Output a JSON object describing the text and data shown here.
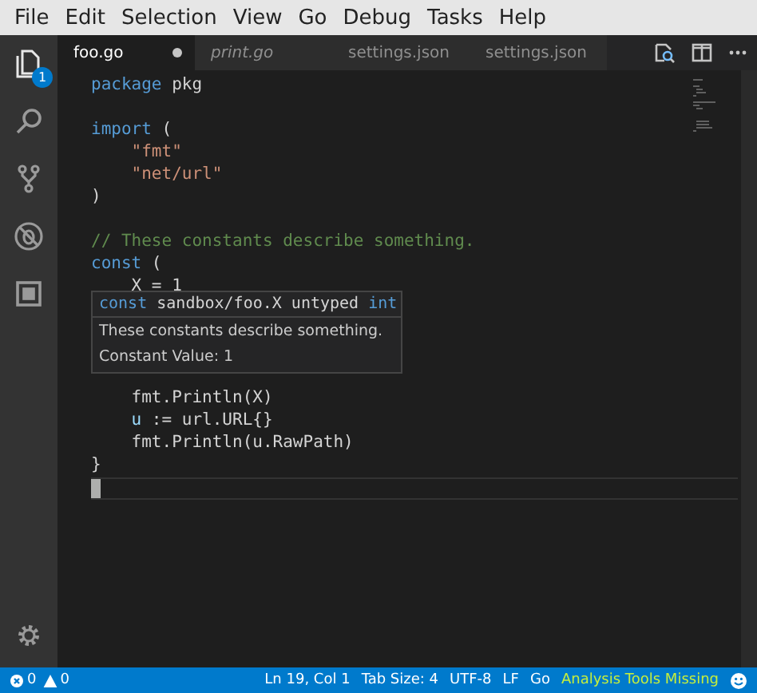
{
  "menu": [
    "File",
    "Edit",
    "Selection",
    "View",
    "Go",
    "Debug",
    "Tasks",
    "Help"
  ],
  "activity_bar": {
    "items": [
      {
        "kind": "files",
        "selected": true,
        "badge": "1"
      },
      {
        "kind": "search",
        "selected": false
      },
      {
        "kind": "source-control",
        "selected": false
      },
      {
        "kind": "debug",
        "selected": false
      },
      {
        "kind": "extensions",
        "selected": false
      }
    ]
  },
  "tabs": [
    {
      "label": "foo.go",
      "selected": true,
      "dirty": true,
      "preview": false
    },
    {
      "label": "print.go",
      "selected": false,
      "dirty": false,
      "preview": true
    },
    {
      "label": "settings.json",
      "selected": false,
      "dirty": false,
      "preview": false
    },
    {
      "label": "settings.json",
      "selected": false,
      "dirty": false,
      "preview": false
    }
  ],
  "code_lines": [
    {
      "kind": "code",
      "tokens": [
        {
          "text": "package",
          "kind": "keyword"
        },
        {
          "text": " pkg",
          "kind": "plain"
        }
      ]
    },
    {
      "kind": "blank"
    },
    {
      "kind": "code",
      "tokens": [
        {
          "text": "import",
          "kind": "keyword"
        },
        {
          "text": " (",
          "kind": "plain"
        }
      ]
    },
    {
      "kind": "code",
      "tokens": [
        {
          "text": "    \"fmt\"",
          "kind": "string"
        }
      ]
    },
    {
      "kind": "code",
      "tokens": [
        {
          "text": "    \"net/url\"",
          "kind": "string"
        }
      ]
    },
    {
      "kind": "code",
      "tokens": [
        {
          "text": ")",
          "kind": "plain"
        }
      ]
    },
    {
      "kind": "blank"
    },
    {
      "kind": "code",
      "tokens": [
        {
          "text": "// These constants describe something.",
          "kind": "comment"
        }
      ]
    },
    {
      "kind": "code",
      "tokens": [
        {
          "text": "const",
          "kind": "keyword"
        },
        {
          "text": " (",
          "kind": "plain"
        }
      ]
    },
    {
      "kind": "code",
      "tokens": [
        {
          "text": "    X = 1",
          "kind": "plain"
        }
      ]
    },
    {
      "kind": "blank"
    },
    {
      "kind": "blank"
    },
    {
      "kind": "blank"
    },
    {
      "kind": "blank"
    },
    {
      "kind": "code",
      "tokens": [
        {
          "text": "    fmt.Println(X)",
          "kind": "plain"
        }
      ]
    },
    {
      "kind": "code",
      "tokens": [
        {
          "text": "    u",
          "kind": "variable"
        },
        {
          "text": " := url.URL{}",
          "kind": "plain"
        }
      ]
    },
    {
      "kind": "code",
      "tokens": [
        {
          "text": "    fmt.Println(u.RawPath)",
          "kind": "plain"
        }
      ]
    },
    {
      "kind": "code",
      "tokens": [
        {
          "text": "}",
          "kind": "plain"
        }
      ]
    },
    {
      "kind": "blank"
    }
  ],
  "hover": {
    "signature": [
      {
        "text": "const",
        "kind": "keyword"
      },
      {
        "text": " sandbox/foo.X untyped ",
        "kind": "plain"
      },
      {
        "text": "int",
        "kind": "keyword"
      }
    ],
    "doc": "These constants describe something.",
    "value": "Constant Value: 1"
  },
  "status_bar": {
    "errors": "0",
    "warnings": "0",
    "items": [
      "Ln 19, Col 1",
      "Tab Size: 4",
      "UTF-8",
      "LF",
      "Go"
    ],
    "warning_item": "Analysis Tools Missing"
  }
}
